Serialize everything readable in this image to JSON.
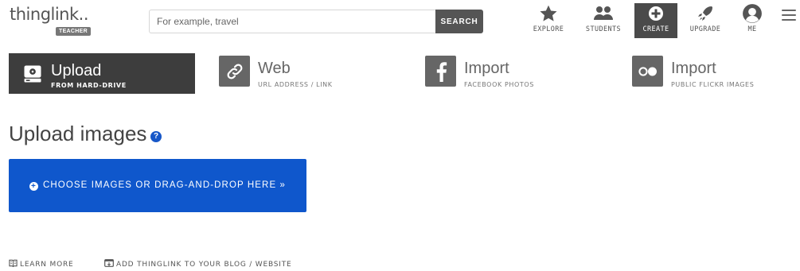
{
  "header": {
    "logo_text": "thinglink..",
    "logo_badge": "TEACHER",
    "search_placeholder": "For example, travel",
    "search_button": "SEARCH",
    "nav": [
      {
        "label": "EXPLORE",
        "icon": "star-icon"
      },
      {
        "label": "STUDENTS",
        "icon": "students-icon"
      },
      {
        "label": "CREATE",
        "icon": "plus-circle-icon",
        "active": true
      },
      {
        "label": "UPGRADE",
        "icon": "rocket-icon"
      },
      {
        "label": "ME",
        "icon": "user-avatar-icon"
      }
    ],
    "menu_icon": "hamburger-menu-icon"
  },
  "tabs": [
    {
      "title": "Upload",
      "subtitle": "FROM HARD-DRIVE",
      "icon": "hard-drive-icon",
      "active": true
    },
    {
      "title": "Web",
      "subtitle": "URL ADDRESS / LINK",
      "icon": "link-icon"
    },
    {
      "title": "Import",
      "subtitle": "FACEBOOK PHOTOS",
      "icon": "facebook-icon"
    },
    {
      "title": "Import",
      "subtitle": "PUBLIC FLICKR IMAGES",
      "icon": "flickr-icon"
    }
  ],
  "main": {
    "heading": "Upload images",
    "help_icon_glyph": "?",
    "choose_button": "CHOOSE IMAGES OR DRAG-AND-DROP HERE »"
  },
  "footer": {
    "learn_more": "LEARN MORE",
    "add_to_blog": "ADD THINGLINK TO YOUR BLOG / WEBSITE"
  },
  "colors": {
    "accent_blue": "#0f57cc",
    "dark_gray": "#4a4a4a",
    "tab_active": "#3d3d3d"
  }
}
